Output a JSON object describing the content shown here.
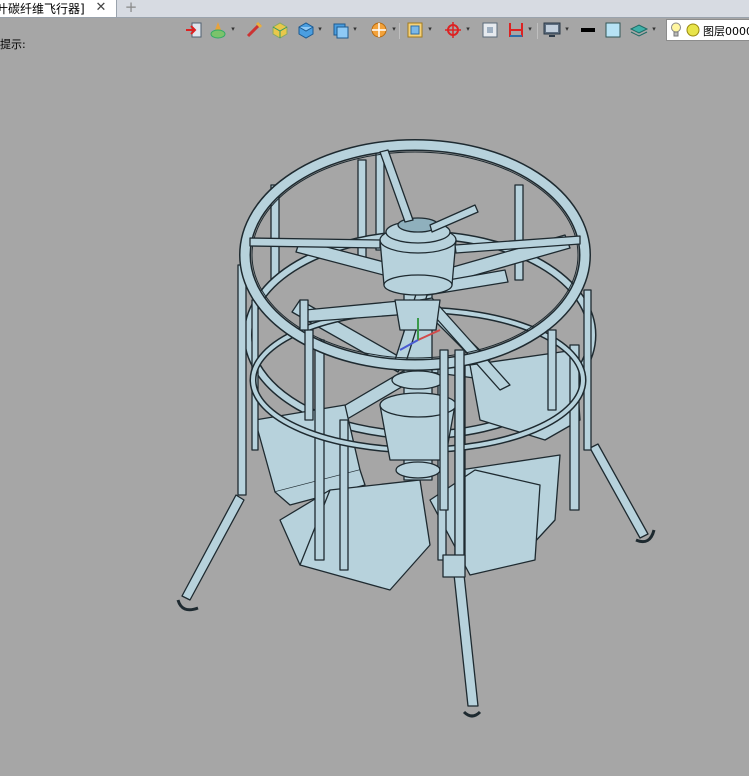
{
  "tab": {
    "title": "叶碳纤维飞行器]",
    "close_glyph": "✕",
    "add_glyph": "+"
  },
  "layer": {
    "name": "图层0000"
  },
  "status": {
    "hint": "提示:"
  },
  "toolbar": {
    "icons": [
      "exit-sketch-icon",
      "render-mode-icon",
      "line-style-icon",
      "box-icon",
      "solid-view-icon",
      "face-icon",
      "filter-icon",
      "snap-icon",
      "view-icon",
      "axis-icon",
      "frame-icon",
      "display-icon",
      "line-color-icon",
      "fill-color-icon",
      "layer-stack-icon",
      "lightbulb-icon",
      "sun-icon"
    ]
  },
  "colors": {
    "model": "#b7d2dc",
    "model_edge": "#1e2a30",
    "background": "#a6a6a6"
  }
}
